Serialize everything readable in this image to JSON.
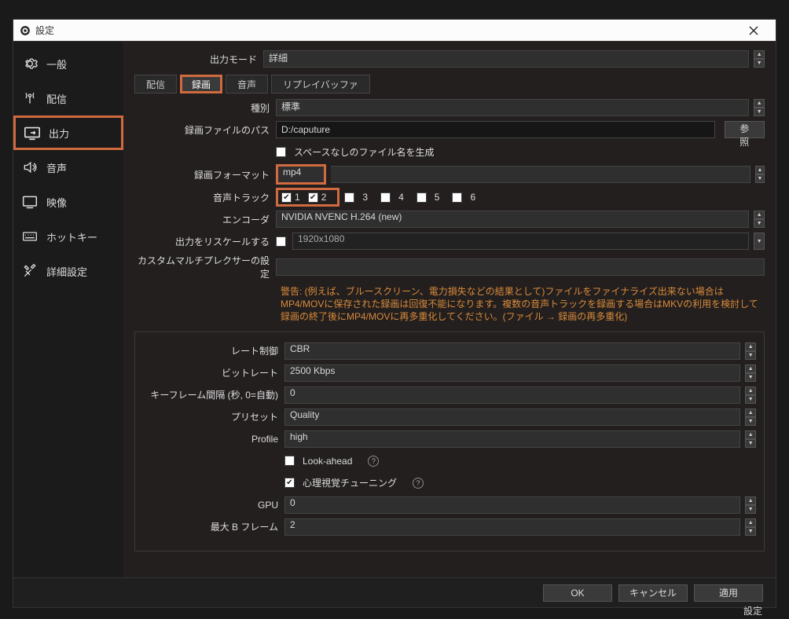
{
  "titlebar": {
    "title": "設定"
  },
  "sidebar": {
    "items": [
      {
        "label": "一般"
      },
      {
        "label": "配信"
      },
      {
        "label": "出力"
      },
      {
        "label": "音声"
      },
      {
        "label": "映像"
      },
      {
        "label": "ホットキー"
      },
      {
        "label": "詳細設定"
      }
    ]
  },
  "output_mode": {
    "label": "出力モード",
    "value": "詳細"
  },
  "tabs": [
    {
      "label": "配信"
    },
    {
      "label": "録画"
    },
    {
      "label": "音声"
    },
    {
      "label": "リプレイバッファ"
    }
  ],
  "recording": {
    "type_label": "種別",
    "type_value": "標準",
    "path_label": "録画ファイルのパス",
    "path_value": "D:/caputure",
    "browse": "参照",
    "no_space_label": "スペースなしのファイル名を生成",
    "format_label": "録画フォーマット",
    "format_value": "mp4",
    "tracks_label": "音声トラック",
    "tracks": [
      "1",
      "2",
      "3",
      "4",
      "5",
      "6"
    ],
    "encoder_label": "エンコーダ",
    "encoder_value": "NVIDIA NVENC H.264 (new)",
    "rescale_label": "出力をリスケールする",
    "rescale_value": "1920x1080",
    "mux_label": "カスタムマルチプレクサーの設定"
  },
  "warning": "警告: (例えば、ブルースクリーン、電力損失などの結果として)ファイルをファイナライズ出来ない場合はMP4/MOVに保存された録画は回復不能になります。複数の音声トラックを録画する場合はMKVの利用を検討して録画の終了後にMP4/MOVに再多重化してください。(ファイル → 録画の再多重化)",
  "encoder": {
    "rate_label": "レート制御",
    "rate_value": "CBR",
    "bitrate_label": "ビットレート",
    "bitrate_value": "2500 Kbps",
    "keyint_label": "キーフレーム間隔 (秒, 0=自動)",
    "keyint_value": "0",
    "preset_label": "プリセット",
    "preset_value": "Quality",
    "profile_label": "Profile",
    "profile_value": "high",
    "lookahead_label": "Look-ahead",
    "psy_label": "心理視覚チューニング",
    "gpu_label": "GPU",
    "gpu_value": "0",
    "bframes_label": "最大 B フレーム",
    "bframes_value": "2"
  },
  "footer": {
    "ok": "OK",
    "cancel": "キャンセル",
    "apply": "適用"
  },
  "bottom_label": "設定"
}
